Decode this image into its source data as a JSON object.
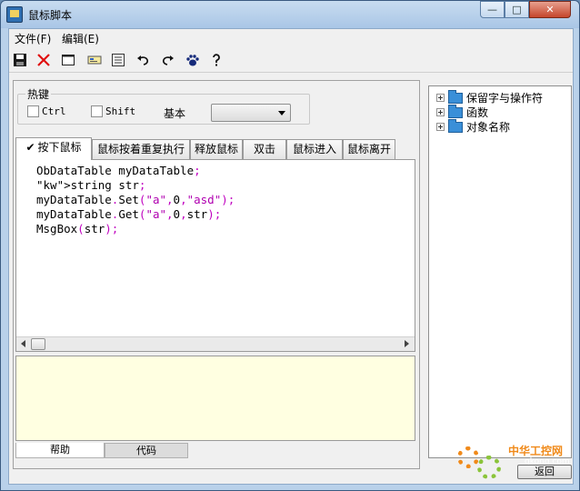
{
  "window": {
    "title": "鼠标脚本",
    "minimize": "—",
    "maximize": "□",
    "close": "✕"
  },
  "menu": {
    "file": "文件(F)",
    "edit": "编辑(E)"
  },
  "toolbar": {
    "icons": [
      "save-icon",
      "delete-icon",
      "new-icon",
      "rename-icon",
      "properties-icon",
      "undo-icon",
      "redo-icon",
      "paw-icon",
      "help-icon"
    ]
  },
  "hotkey": {
    "group_label": "热键",
    "ctrl_label": "Ctrl",
    "shift_label": "Shift",
    "basic_label": "基本",
    "basic_value": ""
  },
  "tabs": [
    {
      "label": "按下鼠标",
      "active": true
    },
    {
      "label": "鼠标按着重复执行"
    },
    {
      "label": "释放鼠标"
    },
    {
      "label": "双击"
    },
    {
      "label": "鼠标进入"
    },
    {
      "label": "鼠标离开"
    }
  ],
  "code": {
    "lines": [
      "ObDataTable myDataTable;",
      "string str;",
      "myDataTable.Set(\"a\",0,\"asd\");",
      "myDataTable.Get(\"a\",0,str);",
      "MsgBox(str);"
    ]
  },
  "bottom_tabs": {
    "help": "帮助",
    "code": "代码"
  },
  "tree": [
    {
      "label": "保留字与操作符"
    },
    {
      "label": "函数"
    },
    {
      "label": "对象名称"
    }
  ],
  "watermark": {
    "brand": "中华工控网",
    "url": "gkong.com"
  },
  "back_button": "返回",
  "colors": {
    "keyword": "#0000c0",
    "punct": "#c000c0",
    "help_bg": "#ffffe1"
  }
}
